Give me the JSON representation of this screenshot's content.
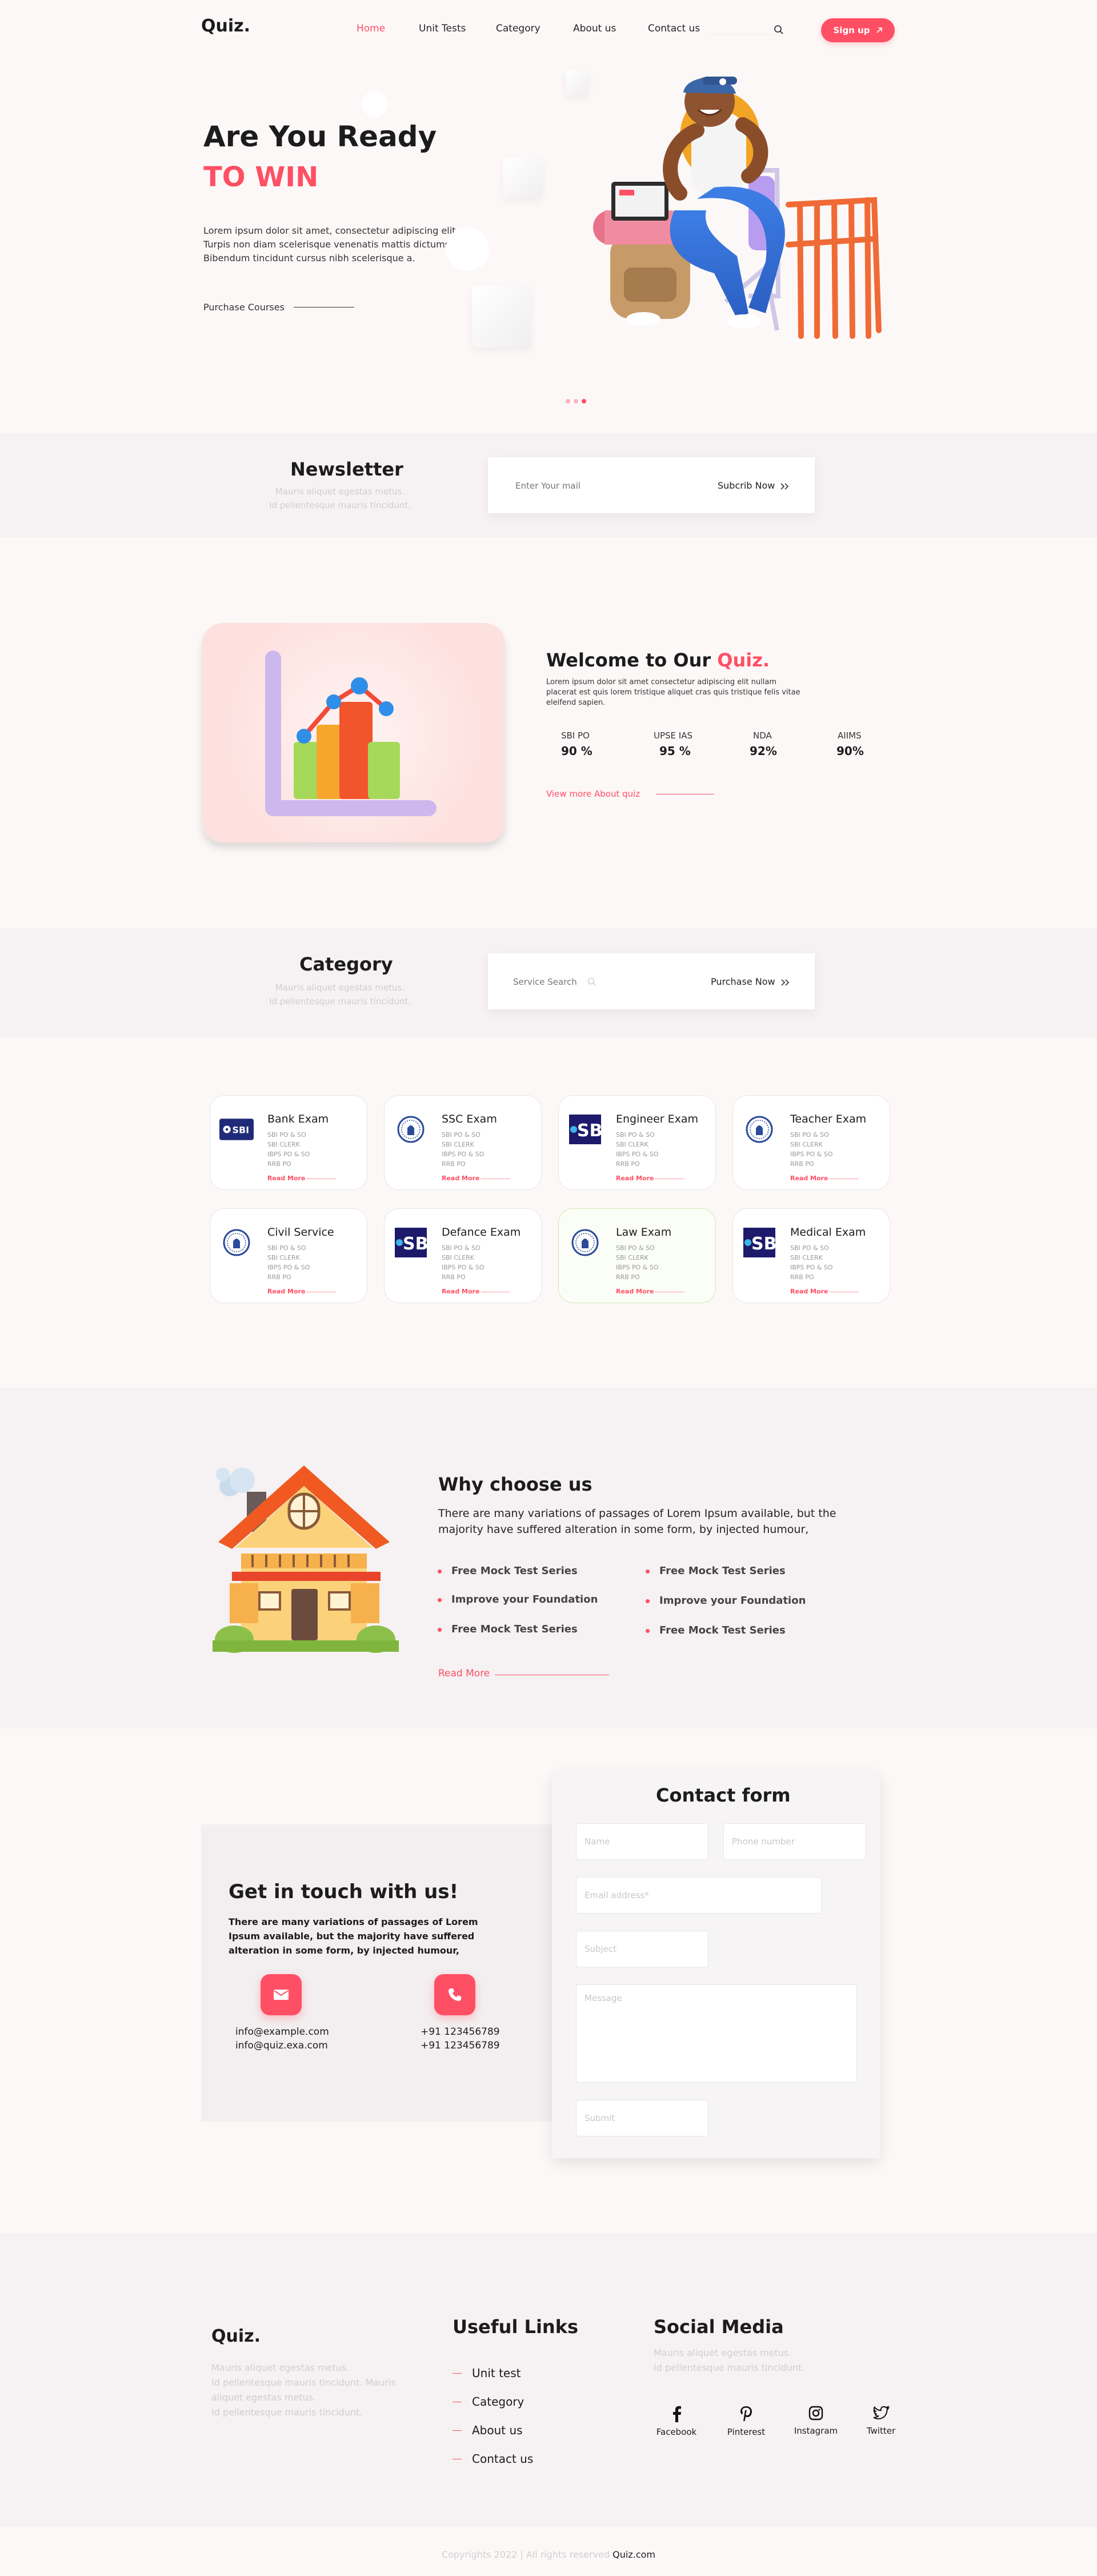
{
  "nav": {
    "logo": "Quiz.",
    "items": [
      {
        "label": "Home",
        "active": true
      },
      {
        "label": "Unit Tests",
        "active": false
      },
      {
        "label": "Category",
        "active": false
      },
      {
        "label": "About us",
        "active": false
      },
      {
        "label": "Contact us",
        "active": false
      }
    ],
    "signup_label": "Sign up",
    "search_icon": "search-icon"
  },
  "hero": {
    "title": "Are You Ready",
    "subtitle": "TO WIN",
    "description": "Lorem ipsum dolor sit amet, consectetur adipiscing elit. Turpis non diam scelerisque venenatis mattis dictumst. Bibendum tincidunt cursus nibh scelerisque a.",
    "link": "Purchase  Courses",
    "slides": 3,
    "active_slide": 3
  },
  "newsletter": {
    "title": "Newsletter",
    "text_line1": "Mauris aliquet egestas metus.",
    "text_line2": "Id pellentesque mauris tincidunt.",
    "input_placeholder": "Enter Your mail",
    "button": "Subcrib Now"
  },
  "welcome": {
    "title_prefix": "Welcome to Our ",
    "title_highlight": "Quiz.",
    "description": "Lorem ipsum dolor sit amet consectetur adipiscing elit nullam placerat est quis lorem tristique aliquet cras quis tristique felis vitae eleifend sapien.",
    "stats": [
      {
        "label": "SBI PO",
        "value": "90 %"
      },
      {
        "label": "UPSE IAS",
        "value": "95 %"
      },
      {
        "label": "NDA",
        "value": "92%"
      },
      {
        "label": "AIIMS",
        "value": "90%"
      }
    ],
    "link": "View more About quiz"
  },
  "category": {
    "title": "Category",
    "text_line1": "Mauris aliquet egestas metus.",
    "text_line2": "Id pellentesque mauris tincidunt.",
    "search_placeholder": "Service Search",
    "button": "Purchase Now",
    "cards": [
      {
        "title": "Bank Exam",
        "logo": "SBI",
        "items": [
          "SBI PO & SO",
          "SBI CLERK",
          "IBPS PO & SO",
          "RRB PO"
        ],
        "more": "Read More"
      },
      {
        "title": "SSC Exam",
        "logo": "emblem",
        "items": [
          "SBI PO & SO",
          "SBI CLERK",
          "IBPS PO & SO",
          "RRB PO"
        ],
        "more": "Read More"
      },
      {
        "title": "Engineer Exam",
        "logo": "SB",
        "items": [
          "SBI PO & SO",
          "SBI CLERK",
          "IBPS PO & SO",
          "RRB PO"
        ],
        "more": "Read More"
      },
      {
        "title": "Teacher Exam",
        "logo": "emblem",
        "items": [
          "SBI PO & SO",
          "SBI CLERK",
          "IBPS PO & SO",
          "RRB PO"
        ],
        "more": "Read More"
      },
      {
        "title": "Civil Service",
        "logo": "emblem",
        "items": [
          "SBI PO & SO",
          "SBI CLERK",
          "IBPS PO & SO",
          "RRB PO"
        ],
        "more": "Read More"
      },
      {
        "title": "Defance Exam",
        "logo": "SB",
        "items": [
          "SBI PO & SO",
          "SBI CLERK",
          "IBPS PO & SO",
          "RRB PO"
        ],
        "more": "Read More"
      },
      {
        "title": "Law Exam",
        "logo": "emblem",
        "items": [
          "SBI PO & SO",
          "SBI CLERK",
          "IBPS PO & SO",
          "RRB PO"
        ],
        "more": "Read More"
      },
      {
        "title": "Medical Exam",
        "logo": "SB",
        "items": [
          "SBI PO & SO",
          "SBI CLERK",
          "IBPS PO & SO",
          "RRB PO"
        ],
        "more": "Read More"
      }
    ]
  },
  "why": {
    "title": "Why choose us",
    "description": "There are many variations of passages of Lorem Ipsum available, but the majority have suffered alteration in some form, by injected humour,",
    "items_left": [
      "Free Mock Test Series",
      "Improve your Foundation",
      "Free Mock Test Series"
    ],
    "items_right": [
      "Free Mock Test Series",
      "Improve your Foundation",
      "Free Mock Test Series"
    ],
    "link": "Read More"
  },
  "contact": {
    "title": "Get in touch with us!",
    "description": "There are many variations of passages of Lorem Ipsum available, but the majority have suffered alteration in some form, by injected humour,",
    "emails": [
      "info@example.com",
      "info@quiz.exa.com"
    ],
    "phones": [
      "+91 123456789",
      "+91 123456789"
    ],
    "form": {
      "title": "Contact form",
      "name_placeholder": "Name",
      "phone_placeholder": "Phone number",
      "email_placeholder": "Email address*",
      "subject_placeholder": "Subject",
      "message_placeholder": "Message",
      "submit": "Submit"
    }
  },
  "footer": {
    "logo": "Quiz.",
    "about_lines": [
      "Mauris aliquet egestas metus.",
      "Id pellentesque mauris tincidunt. Mauris",
      "aliquet egestas metus.",
      "Id pellentesque mauris tincidunt."
    ],
    "links_title": "Useful Links",
    "links": [
      "Unit test",
      "Category",
      "About us",
      "Contact us"
    ],
    "social_title": "Social Media",
    "social_lines": [
      "Mauris aliquet egestas metus.",
      "Id pellentesque mauris tincidunt."
    ],
    "social": [
      {
        "label": "Facebook",
        "icon": "facebook-icon"
      },
      {
        "label": "Pinterest",
        "icon": "pinterest-icon"
      },
      {
        "label": "Instagram",
        "icon": "instagram-icon"
      },
      {
        "label": "Twitter",
        "icon": "twitter-icon"
      }
    ],
    "copyright_prefix": "Copyrights 2022 | All rights reserved ",
    "copyright_brand": "Quiz.com"
  },
  "colors": {
    "accent": "#ff4f64",
    "background": "#fdf8f8",
    "band": "#f6f1f2"
  }
}
